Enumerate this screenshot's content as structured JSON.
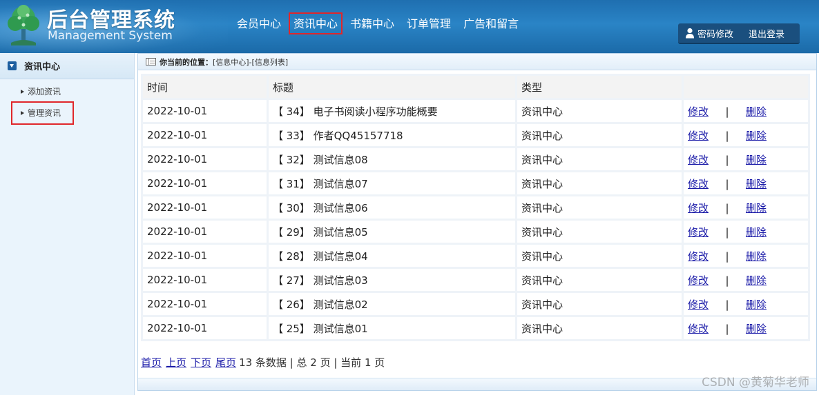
{
  "header": {
    "title_cn": "后台管理系统",
    "title_en": "Management System",
    "nav": [
      {
        "label": "会员中心",
        "active": false
      },
      {
        "label": "资讯中心",
        "active": true
      },
      {
        "label": "书籍中心",
        "active": false
      },
      {
        "label": "订单管理",
        "active": false
      },
      {
        "label": "广告和留言",
        "active": false
      }
    ],
    "change_password": "密码修改",
    "logout": "退出登录"
  },
  "sidebar": {
    "title": "资讯中心",
    "items": [
      {
        "label": "添加资讯"
      },
      {
        "label": "管理资讯",
        "highlighted": true
      }
    ]
  },
  "breadcrumb": {
    "label": "你当前的位置：",
    "path": "[信息中心]-[信息列表]"
  },
  "table": {
    "columns": [
      "时间",
      "标题",
      "类型",
      ""
    ],
    "rows": [
      {
        "time": "2022-10-01",
        "title": "【 34】 电子书阅读小程序功能概要",
        "type": "资讯中心"
      },
      {
        "time": "2022-10-01",
        "title": "【 33】 作者QQ45157718",
        "type": "资讯中心"
      },
      {
        "time": "2022-10-01",
        "title": "【 32】 测试信息08",
        "type": "资讯中心"
      },
      {
        "time": "2022-10-01",
        "title": "【 31】 测试信息07",
        "type": "资讯中心"
      },
      {
        "time": "2022-10-01",
        "title": "【 30】 测试信息06",
        "type": "资讯中心"
      },
      {
        "time": "2022-10-01",
        "title": "【 29】 测试信息05",
        "type": "资讯中心"
      },
      {
        "time": "2022-10-01",
        "title": "【 28】 测试信息04",
        "type": "资讯中心"
      },
      {
        "time": "2022-10-01",
        "title": "【 27】 测试信息03",
        "type": "资讯中心"
      },
      {
        "time": "2022-10-01",
        "title": "【 26】 测试信息02",
        "type": "资讯中心"
      },
      {
        "time": "2022-10-01",
        "title": "【 25】 测试信息01",
        "type": "资讯中心"
      }
    ],
    "edit_label": "修改",
    "separator": "|",
    "delete_label": "删除"
  },
  "pager": {
    "first": "首页",
    "prev": "上页",
    "next": "下页",
    "last": "尾页",
    "info": "13 条数据 | 总 2 页 | 当前 1 页"
  },
  "watermark": "CSDN @黄菊华老师",
  "colors": {
    "header_blue": "#2a84c6",
    "highlight_red": "#e0262a",
    "link_blue": "#1a1aa8"
  },
  "icons": {
    "logo": "tree-logo-icon",
    "user": "user-icon",
    "sidebar": "chevron-down-icon",
    "breadcrumb": "list-icon",
    "side_items": "caret-right-icon"
  }
}
